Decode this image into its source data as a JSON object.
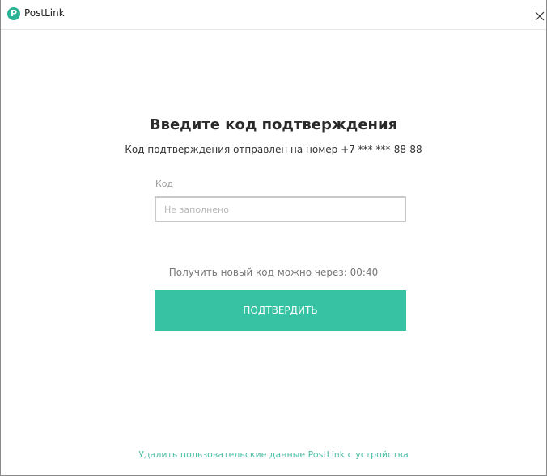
{
  "window": {
    "title": "PostLink",
    "logo_letter": "P",
    "close_icon": "close-icon"
  },
  "content": {
    "heading": "Введите код подтверждения",
    "subtitle": "Код подтверждения отправлен на номер +7  *** ***-88-88",
    "code_field": {
      "label": "Код",
      "placeholder": "Не заполнено",
      "value": ""
    },
    "timer_text": "Получить новый код можно через: 00:40",
    "confirm_button": "ПОДТВЕРДИТЬ",
    "delete_link": "Удалить пользовательские данные PostLink с устройства"
  },
  "colors": {
    "accent": "#37c2a4",
    "link": "#4dbfa6",
    "logo": "#2bb395"
  }
}
